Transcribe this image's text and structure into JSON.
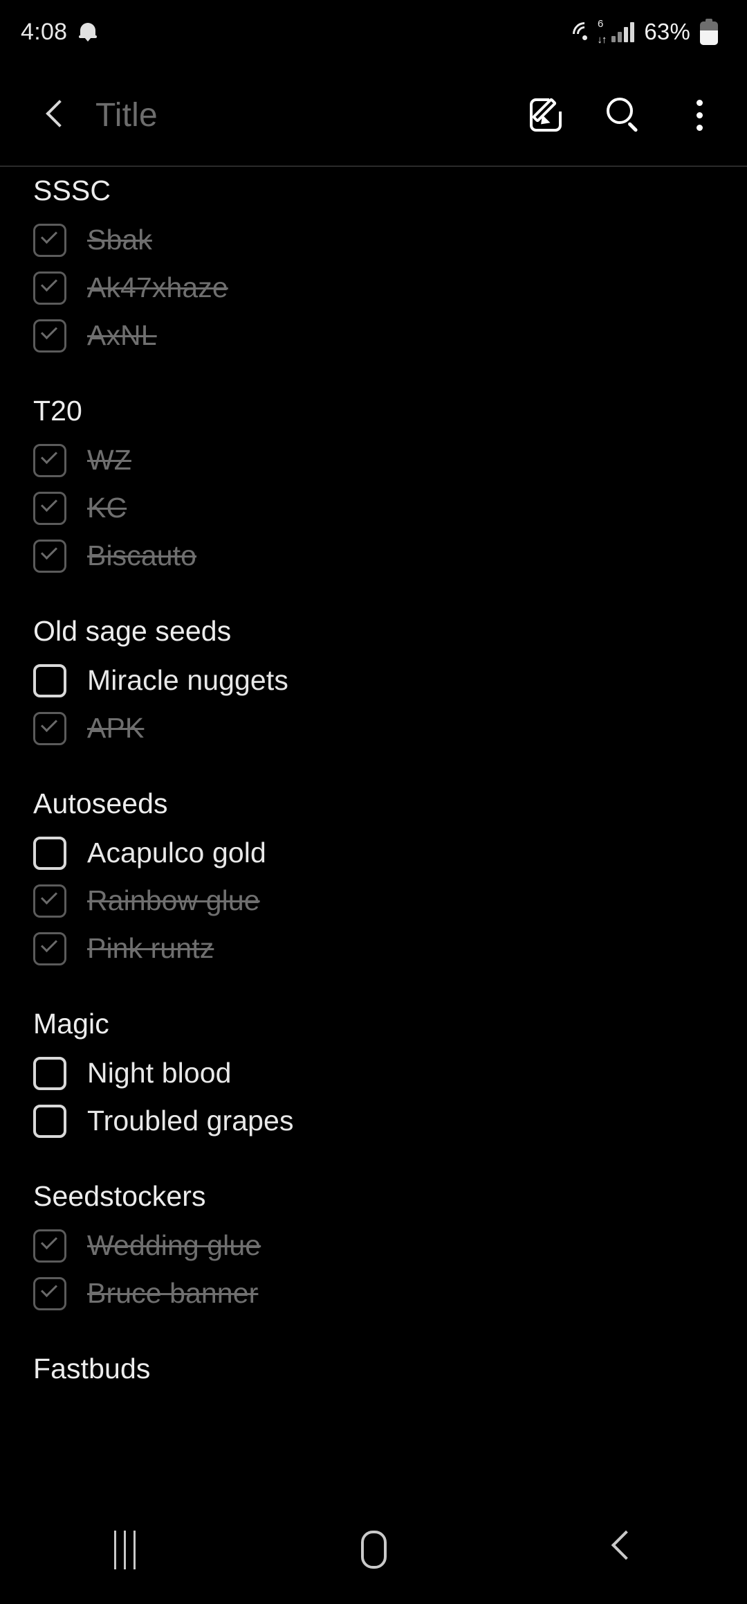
{
  "status_bar": {
    "time": "4:08",
    "notification_icon": "bell-icon",
    "wifi": {
      "icon": "wifi-icon",
      "generation": "6",
      "transfer": "↓↑"
    },
    "signal_icon": "cellular-signal-icon",
    "battery_percent": "63%",
    "battery_level": 63
  },
  "app_bar": {
    "back_icon": "back-chevron-icon",
    "title": "Title",
    "actions": [
      {
        "icon": "compose-icon",
        "label": "Compose"
      },
      {
        "icon": "search-icon",
        "label": "Search"
      },
      {
        "icon": "more-options-icon",
        "label": "More options"
      }
    ]
  },
  "checklist": {
    "groups": [
      {
        "title": "SSSC",
        "items": [
          {
            "label": "Sbak",
            "checked": true
          },
          {
            "label": "Ak47xhaze",
            "checked": true
          },
          {
            "label": "AxNL",
            "checked": true
          }
        ]
      },
      {
        "title": "T20",
        "items": [
          {
            "label": "WZ",
            "checked": true
          },
          {
            "label": "KC",
            "checked": true
          },
          {
            "label": "Biscauto",
            "checked": true
          }
        ]
      },
      {
        "title": "Old sage seeds",
        "items": [
          {
            "label": "Miracle nuggets",
            "checked": false
          },
          {
            "label": "APK",
            "checked": true
          }
        ]
      },
      {
        "title": "Autoseeds",
        "items": [
          {
            "label": "Acapulco gold",
            "checked": false
          },
          {
            "label": "Rainbow glue",
            "checked": true
          },
          {
            "label": "Pink runtz",
            "checked": true
          }
        ]
      },
      {
        "title": "Magic",
        "items": [
          {
            "label": "Night blood",
            "checked": false
          },
          {
            "label": "Troubled grapes",
            "checked": false
          }
        ]
      },
      {
        "title": "Seedstockers",
        "items": [
          {
            "label": "Wedding glue",
            "checked": true
          },
          {
            "label": "Bruce banner",
            "checked": true
          }
        ]
      },
      {
        "title": "Fastbuds",
        "items": []
      }
    ]
  },
  "nav_bar": {
    "recents_icon": "recents-icon",
    "home_icon": "home-icon",
    "back_icon": "nav-back-icon"
  },
  "colors": {
    "background": "#000000",
    "text_primary": "#e8e8e8",
    "text_completed": "#6f6f6f",
    "title_placeholder": "#6d6d6d",
    "divider": "#2a2a2a",
    "checkbox_unchecked": "#d9d9d9",
    "checkbox_checked": "#5b5b5b"
  }
}
